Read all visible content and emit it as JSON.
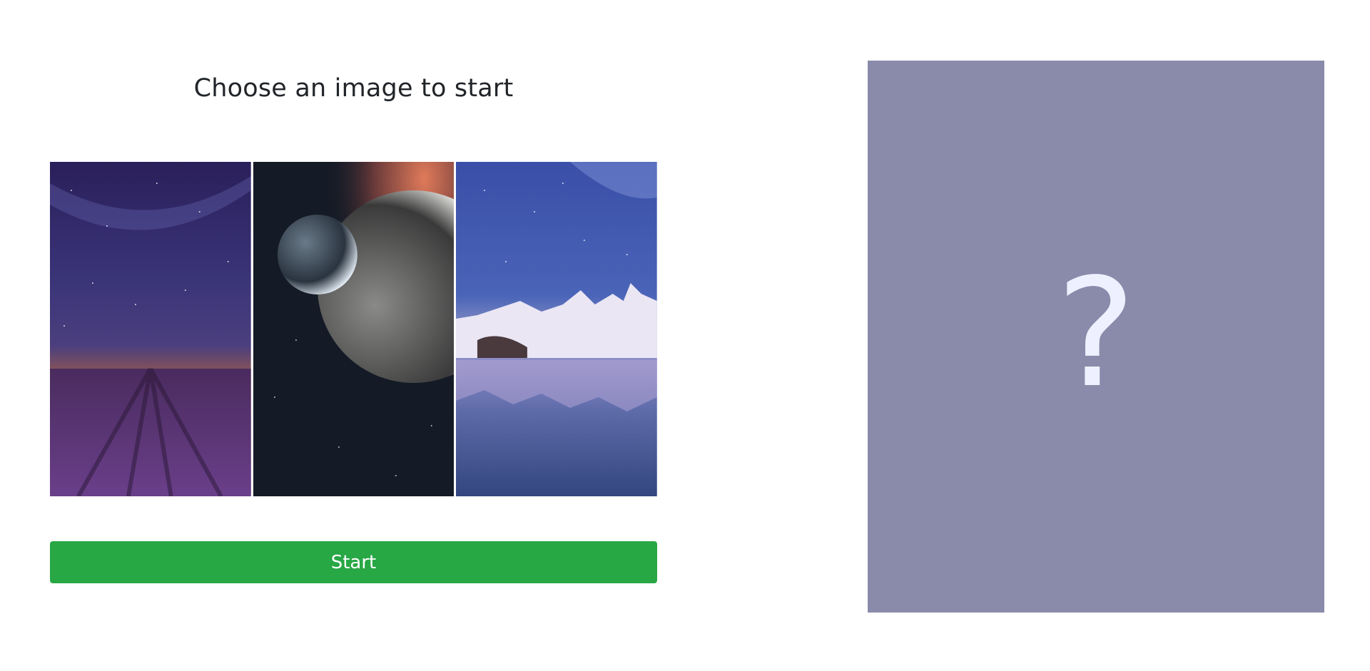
{
  "header": {
    "title": "Choose an image to start"
  },
  "gallery": {
    "images": [
      {
        "subject": "lavender-field-starry-sky"
      },
      {
        "subject": "planets-in-space"
      },
      {
        "subject": "snowy-mountains-lake-reflection"
      }
    ]
  },
  "actions": {
    "start_label": "Start"
  },
  "preview": {
    "placeholder": "?"
  },
  "colors": {
    "start_button": "#28a745",
    "preview_background": "#8a8aaa",
    "title_text": "#212529"
  }
}
